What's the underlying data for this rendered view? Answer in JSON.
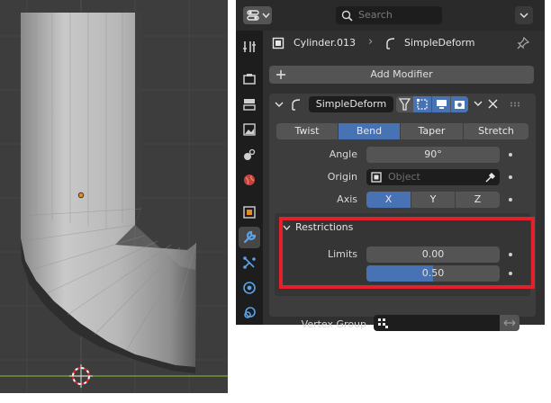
{
  "header": {
    "search_placeholder": "Search"
  },
  "breadcrumb": {
    "object": "Cylinder.013",
    "modifier": "SimpleDeform"
  },
  "add_modifier_label": "Add Modifier",
  "modifier": {
    "name": "SimpleDeform",
    "modes": [
      "Twist",
      "Bend",
      "Taper",
      "Stretch"
    ],
    "selected_mode": "Bend",
    "angle_label": "Angle",
    "angle_value": "90°",
    "origin_label": "Origin",
    "origin_placeholder": "Object",
    "axis_label": "Axis",
    "axes": [
      "X",
      "Y",
      "Z"
    ],
    "selected_axis": "X",
    "restrictions": {
      "title": "Restrictions",
      "limits_label": "Limits",
      "limit_min": "0.00",
      "limit_max": "0.50",
      "limit_max_fraction": 0.5
    },
    "vertex_group_label": "Vertex Group"
  },
  "colors": {
    "highlight": "#4772b3",
    "annotation": "#e5202b",
    "viewport_grid_axis": "#6c9a32",
    "origin_point": "#e58a23"
  },
  "icons": [
    "editor-type-icon",
    "search-icon",
    "chevron-down-icon",
    "tool-icon",
    "render-icon",
    "output-icon",
    "view-layer-icon",
    "scene-icon",
    "world-icon",
    "object-icon",
    "modifier-wrench-icon",
    "particles-icon",
    "physics-icon",
    "constraints-icon",
    "object-data-icon",
    "simple-deform-icon",
    "pin-icon",
    "plus-icon",
    "eyedropper-icon",
    "vertex-group-icon",
    "close-icon",
    "drag-grip-icon"
  ]
}
